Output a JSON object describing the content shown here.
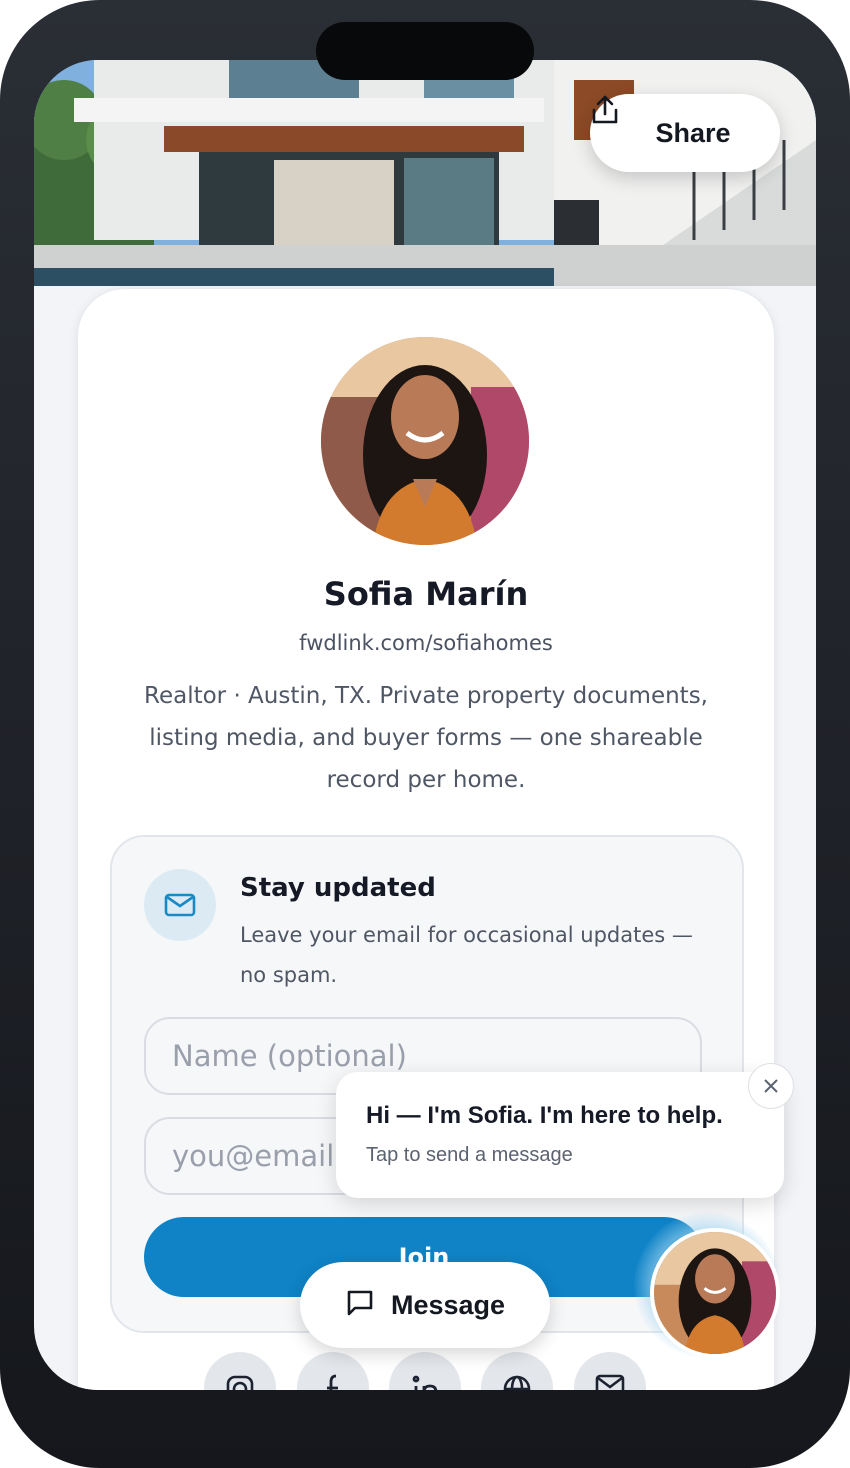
{
  "header": {
    "share_label": "Share"
  },
  "profile": {
    "name": "Sofia Marín",
    "link": "fwdlink.com/sofiahomes",
    "bio": "Realtor · Austin, TX. Private property documents, listing media, and buyer forms — one shareable record per home."
  },
  "subscribe": {
    "title": "Stay updated",
    "description": "Leave your email for occasional updates — no spam.",
    "name_placeholder": "Name (optional)",
    "email_placeholder": "you@email",
    "join_label": "Join"
  },
  "chat": {
    "greeting": "Hi — I'm Sofia. I'm here to help.",
    "subtext": "Tap to send a message",
    "message_label": "Message"
  },
  "socials": [
    "instagram-icon",
    "facebook-icon",
    "linkedin-icon",
    "globe-icon",
    "mail-icon"
  ],
  "colors": {
    "accent": "#0f83c6",
    "text": "#151a26"
  }
}
